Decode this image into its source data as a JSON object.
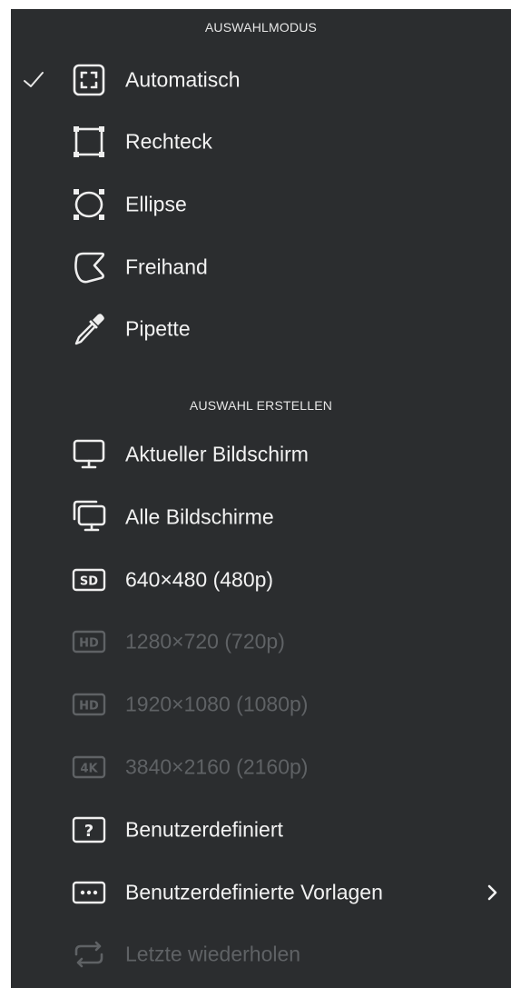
{
  "colors": {
    "menu_background": "#2b2d2f",
    "text": "#f2f2f2",
    "disabled_text": "#5f6265",
    "header_text": "#e6e6e6"
  },
  "sections": {
    "selection_mode_header": "AUSWAHLMODUS",
    "create_selection_header": "AUSWAHL ERSTELLEN"
  },
  "selection_mode": {
    "items": [
      {
        "label": "Automatisch",
        "icon": "auto-select-icon",
        "checked": true
      },
      {
        "label": "Rechteck",
        "icon": "rectangle-select-icon"
      },
      {
        "label": "Ellipse",
        "icon": "ellipse-select-icon"
      },
      {
        "label": "Freihand",
        "icon": "freehand-select-icon"
      },
      {
        "label": "Pipette",
        "icon": "eyedropper-icon"
      }
    ]
  },
  "create_selection": {
    "items": [
      {
        "label": "Aktueller Bildschirm",
        "icon": "monitor-icon"
      },
      {
        "label": "Alle Bildschirme",
        "icon": "multi-monitor-icon"
      },
      {
        "label": "640×480 (480p)",
        "icon": "sd-icon",
        "icon_text": "SD"
      },
      {
        "label": "1280×720 (720p)",
        "icon": "hd-icon",
        "icon_text": "HD",
        "disabled": true
      },
      {
        "label": "1920×1080 (1080p)",
        "icon": "hd-icon",
        "icon_text": "HD",
        "disabled": true
      },
      {
        "label": "3840×2160 (2160p)",
        "icon": "4k-icon",
        "icon_text": "4K",
        "disabled": true
      },
      {
        "label": "Benutzerdefiniert",
        "icon": "question-icon",
        "icon_text": "?"
      },
      {
        "label": "Benutzerdefinierte Vorlagen",
        "icon": "more-icon",
        "has_submenu": true
      },
      {
        "label": "Letzte wiederholen",
        "icon": "repeat-icon",
        "disabled": true
      }
    ]
  }
}
